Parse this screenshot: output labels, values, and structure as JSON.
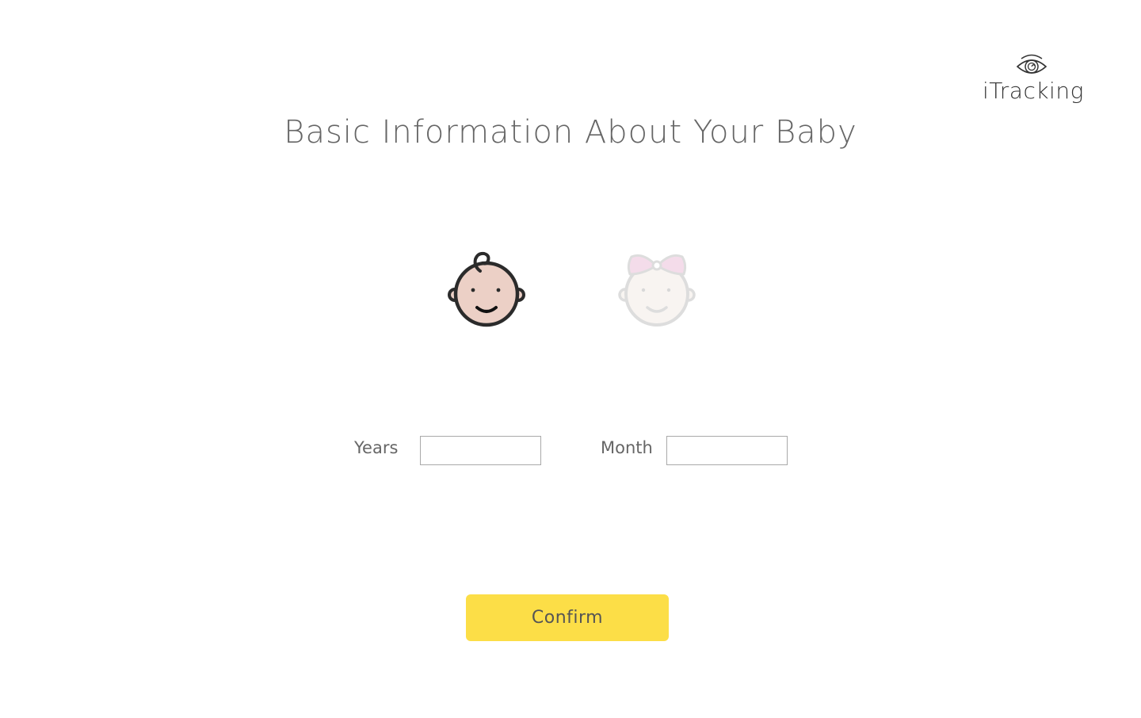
{
  "brand": {
    "name": "iTracking",
    "icon": "eye-icon"
  },
  "header": {
    "title": "Basic Information About Your Baby"
  },
  "gender_options": [
    {
      "id": "boy",
      "icon": "baby-boy-icon",
      "selected": true
    },
    {
      "id": "girl",
      "icon": "baby-girl-icon",
      "selected": false
    }
  ],
  "form": {
    "years_label": "Years",
    "years_value": "",
    "month_label": "Month",
    "month_value": ""
  },
  "actions": {
    "confirm_label": "Confirm"
  },
  "colors": {
    "accent": "#fcde47",
    "title_text": "#666666",
    "boy_face": "#ecd0c6",
    "girl_bow": "#f4dcea"
  }
}
